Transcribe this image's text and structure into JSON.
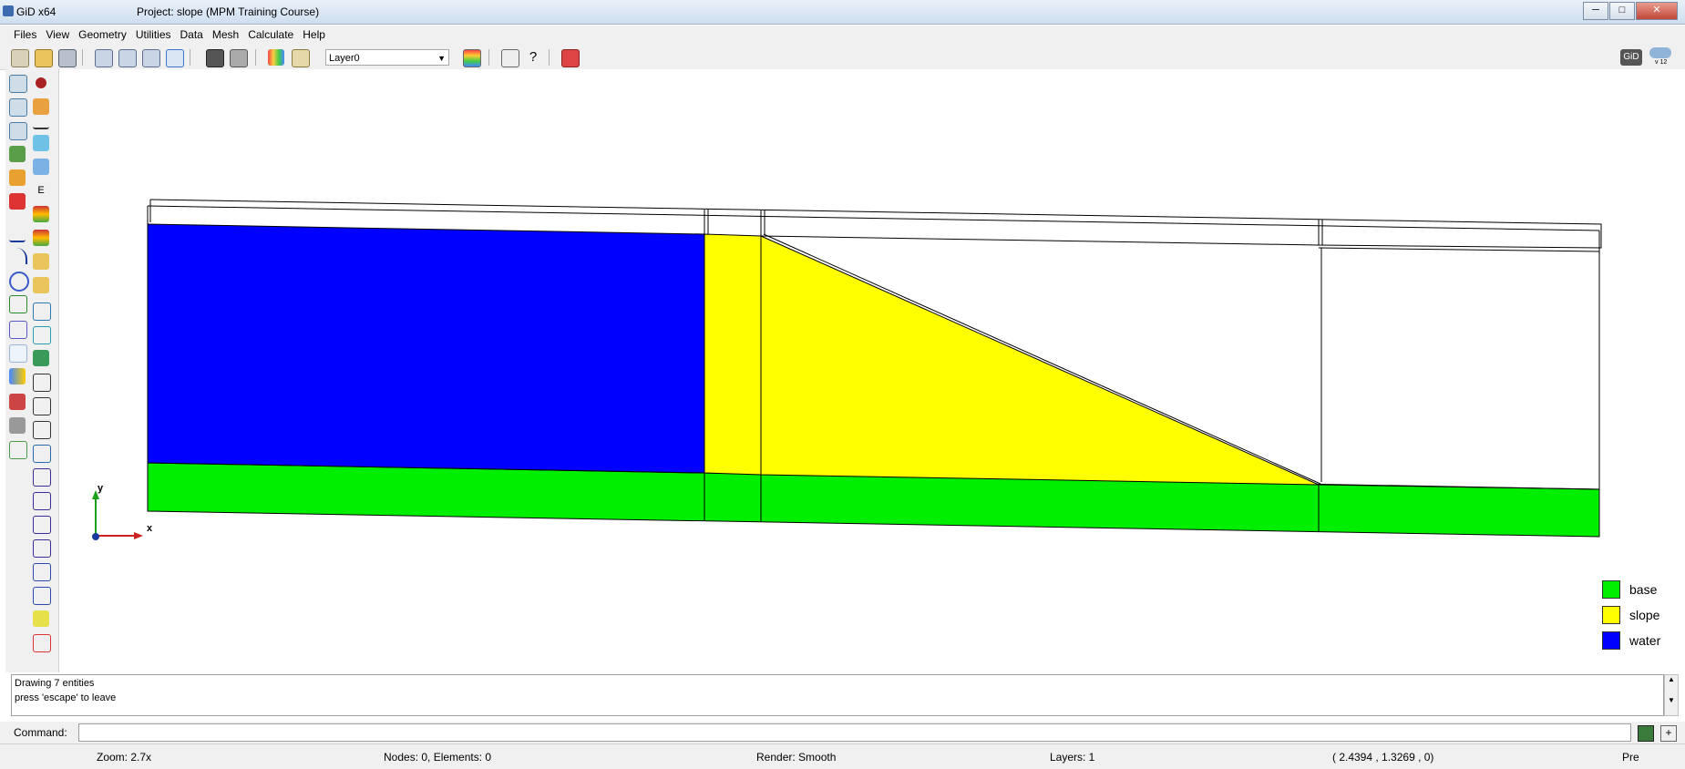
{
  "window": {
    "app_title": "GiD x64",
    "project_title": "Project: slope (MPM Training Course)",
    "buttons": [
      "─",
      "□",
      "✕"
    ]
  },
  "menu": [
    "Files",
    "View",
    "Geometry",
    "Utilities",
    "Data",
    "Mesh",
    "Calculate",
    "Help"
  ],
  "toolbar": {
    "layer_value": "Layer0",
    "gid_badge": "GiD",
    "version": "v 12"
  },
  "legend": [
    {
      "label": "base",
      "color": "#00ee00"
    },
    {
      "label": "slope",
      "color": "#ffff00"
    },
    {
      "label": "water",
      "color": "#0000ff"
    }
  ],
  "axes": {
    "x": "x",
    "y": "y"
  },
  "messages": [
    "Drawing 7 entities",
    "press 'escape' to leave"
  ],
  "command": {
    "label": "Command:",
    "value": ""
  },
  "status": {
    "zoom": "Zoom: 2.7x",
    "nodes": "Nodes: 0, Elements: 0",
    "render": "Render: Smooth",
    "layers": "Layers: 1",
    "coords": "( 2.4394 , 1.3269 , 0)",
    "mode": "Pre"
  }
}
